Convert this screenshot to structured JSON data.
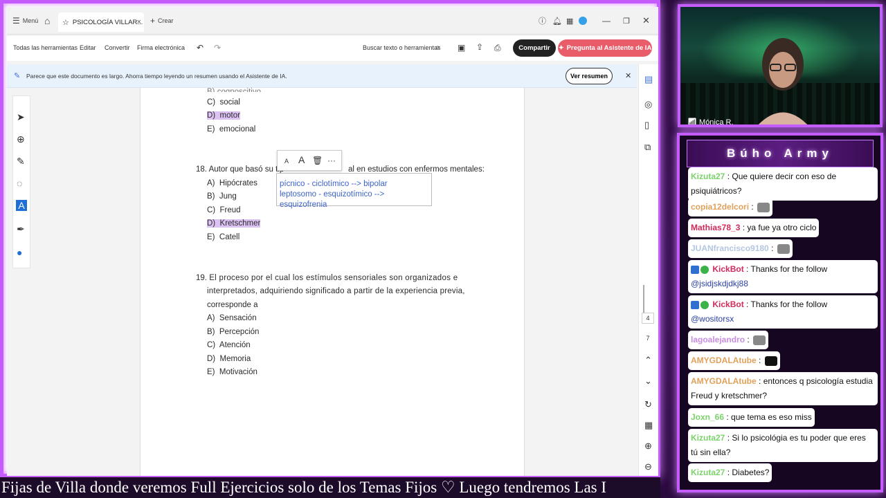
{
  "tabbar": {
    "menu": "Menú",
    "tab_title": "PSICOLOGÍA VILLAR...",
    "create": "Crear"
  },
  "toolbar": {
    "all_tools": "Todas las herramientas",
    "edit": "Editar",
    "convert": "Convertir",
    "sign": "Firma electrónica",
    "search": "Buscar texto o herramientas",
    "share": "Compartir",
    "ai_assistant": "Pregunta al Asistente de IA"
  },
  "banner": {
    "text": "Parece que este documento es largo. Ahorra tiempo leyendo un resumen usando el Asistente de IA.",
    "button": "Ver resumen"
  },
  "document": {
    "prev_options": [
      {
        "letter": "C)",
        "text": "social",
        "highlight": false
      },
      {
        "letter": "D)",
        "text": "motor",
        "highlight": true
      },
      {
        "letter": "E)",
        "text": "emocional",
        "highlight": false
      }
    ],
    "q18": {
      "number": "18.",
      "text_left": "Autor que basó su tip",
      "text_right": "al en estudios con enfermos mentales:",
      "options": [
        {
          "letter": "A)",
          "text": "Hipócrates",
          "highlight": false
        },
        {
          "letter": "B)",
          "text": "Jung",
          "highlight": false
        },
        {
          "letter": "C)",
          "text": "Freud",
          "highlight": false
        },
        {
          "letter": "D)",
          "text": "Kretschmer",
          "highlight": true
        },
        {
          "letter": "E)",
          "text": "Catell",
          "highlight": false
        }
      ]
    },
    "q19": {
      "number": "19.",
      "line1": "El proceso por el cual los estímulos sensoriales son organizados e",
      "line2": "interpretados, adquiriendo significado a partir de la experiencia previa,",
      "line3": "corresponde a",
      "options": [
        {
          "letter": "A)",
          "text": "Sensación"
        },
        {
          "letter": "B)",
          "text": "Percepción"
        },
        {
          "letter": "C)",
          "text": "Atención"
        },
        {
          "letter": "D)",
          "text": "Memoria"
        },
        {
          "letter": "E)",
          "text": "Motivación"
        }
      ]
    },
    "note_line1": "pícnico - ciclotímico --> bipolar",
    "note_line2": "leptosomo - esquizotímico --> esquizofrenia"
  },
  "page_indicator": {
    "current": "4",
    "total": "7"
  },
  "ticker": "Fijas de Villa donde veremos Full Ejercicios solo de los Temas Fijos  ♡  Luego tendremos Las I",
  "camera": {
    "name": "Mónica R."
  },
  "chat": {
    "title": "Búho Army",
    "messages": [
      {
        "user": "",
        "text": "Que quiere decir con eso de psiquiátricos?",
        "color": "#7bd36a"
      },
      {
        "user": "copia12delcori",
        "text": "",
        "color": "#e0a15a",
        "emote": true
      },
      {
        "user": "Mathias78_3",
        "text": "ya fue ya otro ciclo",
        "color": "#d02a5a"
      },
      {
        "user": "JUANfrancisco9180",
        "text": "",
        "color": "#b4c6e0",
        "emote": true
      },
      {
        "user": "KickBot",
        "text": "Thanks for the follow",
        "mention": "@jsidjskdjdkj88",
        "color": "#d02a5a"
      },
      {
        "user": "KickBot",
        "text": "Thanks for the follow",
        "mention": "@wositorsx",
        "color": "#d02a5a"
      },
      {
        "user": "lagoalejandro",
        "text": "",
        "color": "#c88de0",
        "emote": true
      },
      {
        "user": "AMYGDALAtube",
        "text": "",
        "color": "#e0a15a",
        "emote": true
      },
      {
        "user": "AMYGDALAtube",
        "text": "entonces q psicología estudia Freud y kretschmer?",
        "color": "#e0a15a"
      },
      {
        "user": "Joxn_66",
        "text": "que tema es eso miss",
        "color": "#7bd36a"
      },
      {
        "user": "Kizuta27",
        "text": "Si lo psicológia es tu poder que eres tú sin ella?",
        "color": "#7bd36a"
      },
      {
        "user": "Kizuta27",
        "text": "Diabetes?",
        "color": "#7bd36a"
      }
    ]
  }
}
